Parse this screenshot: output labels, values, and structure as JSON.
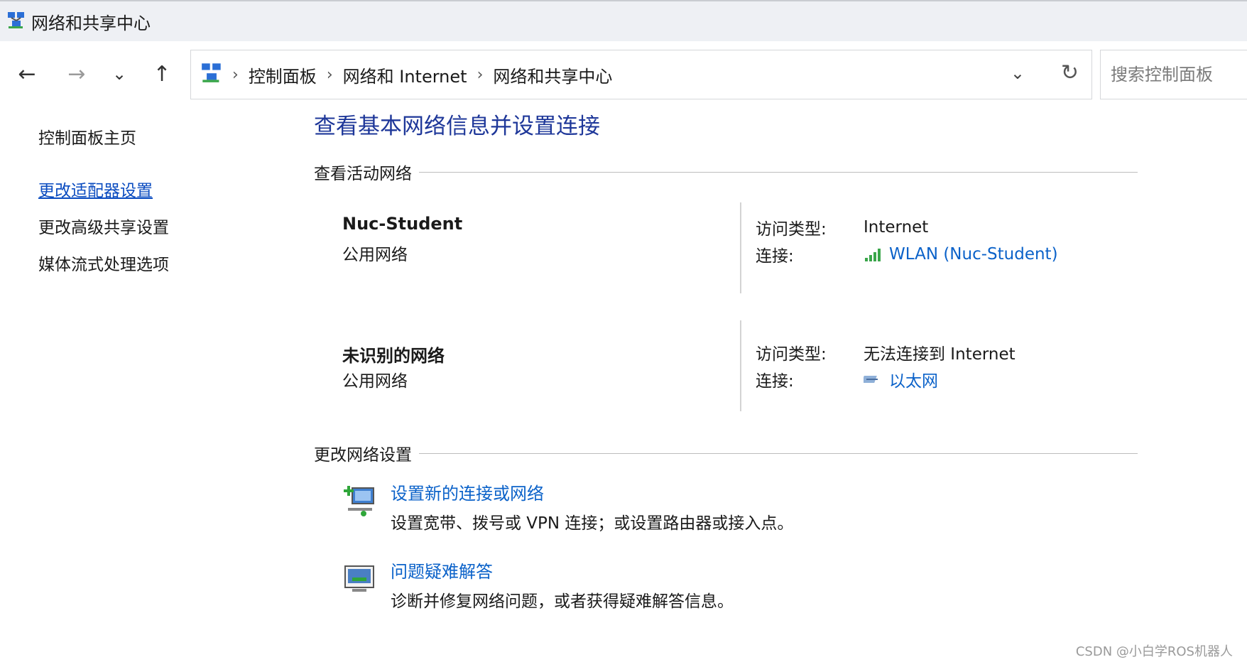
{
  "window": {
    "title": "网络和共享中心"
  },
  "nav": {
    "back_icon": "arrow-left-icon",
    "forward_icon": "arrow-right-icon",
    "recent_icon": "chevron-down-icon",
    "up_icon": "arrow-up-icon"
  },
  "breadcrumb": {
    "items": [
      "控制面板",
      "网络和 Internet",
      "网络和共享中心"
    ],
    "separator": "›"
  },
  "search": {
    "placeholder": "搜索控制面板"
  },
  "sidebar": {
    "home": "控制面板主页",
    "links": [
      "更改适配器设置",
      "更改高级共享设置",
      "媒体流式处理选项"
    ]
  },
  "main": {
    "heading": "查看基本网络信息并设置连接",
    "active_section": "查看活动网络",
    "networks": [
      {
        "name": "Nuc-Student",
        "type": "公用网络",
        "access_label": "访问类型:",
        "access_value": "Internet",
        "conn_label": "连接:",
        "conn_value": "WLAN (Nuc-Student)",
        "conn_icon": "wifi-signal-icon"
      },
      {
        "name": "未识别的网络",
        "type": "公用网络",
        "access_label": "访问类型:",
        "access_value": "无法连接到 Internet",
        "conn_label": "连接:",
        "conn_value": "以太网",
        "conn_icon": "ethernet-icon"
      }
    ],
    "change_section": "更改网络设置",
    "tasks": [
      {
        "link": "设置新的连接或网络",
        "desc": "设置宽带、拨号或 VPN 连接；或设置路由器或接入点。",
        "icon": "new-connection-icon"
      },
      {
        "link": "问题疑难解答",
        "desc": "诊断并修复网络问题，或者获得疑难解答信息。",
        "icon": "troubleshoot-icon"
      }
    ]
  },
  "watermark": "CSDN @小白学ROS机器人",
  "colors": {
    "heading": "#1e3799",
    "link": "#0b62c9",
    "titlebar_bg": "#eef0f4"
  }
}
